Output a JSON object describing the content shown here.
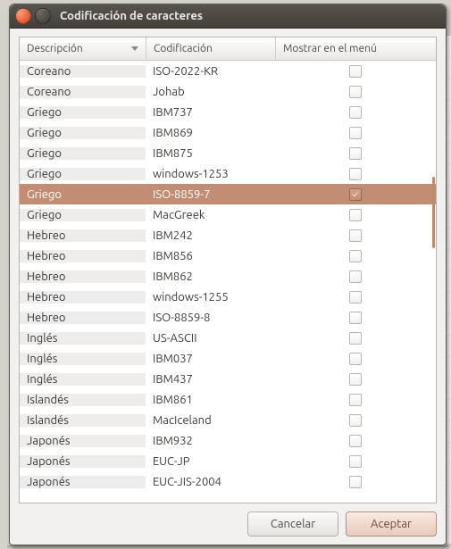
{
  "window": {
    "title": "Codificación de caracteres"
  },
  "table": {
    "headers": {
      "description": "Descripción",
      "encoding": "Codificación",
      "show": "Mostrar en el menú"
    },
    "rows": [
      {
        "desc": "Coreano",
        "enc": "ISO-2022-KR",
        "show": false,
        "selected": false
      },
      {
        "desc": "Coreano",
        "enc": "Johab",
        "show": false,
        "selected": false
      },
      {
        "desc": "Griego",
        "enc": "IBM737",
        "show": false,
        "selected": false
      },
      {
        "desc": "Griego",
        "enc": "IBM869",
        "show": false,
        "selected": false
      },
      {
        "desc": "Griego",
        "enc": "IBM875",
        "show": false,
        "selected": false
      },
      {
        "desc": "Griego",
        "enc": "windows-1253",
        "show": false,
        "selected": false
      },
      {
        "desc": "Griego",
        "enc": "ISO-8859-7",
        "show": true,
        "selected": true
      },
      {
        "desc": "Griego",
        "enc": "MacGreek",
        "show": false,
        "selected": false
      },
      {
        "desc": "Hebreo",
        "enc": "IBM242",
        "show": false,
        "selected": false
      },
      {
        "desc": "Hebreo",
        "enc": "IBM856",
        "show": false,
        "selected": false
      },
      {
        "desc": "Hebreo",
        "enc": "IBM862",
        "show": false,
        "selected": false
      },
      {
        "desc": "Hebreo",
        "enc": "windows-1255",
        "show": false,
        "selected": false
      },
      {
        "desc": "Hebreo",
        "enc": "ISO-8859-8",
        "show": false,
        "selected": false
      },
      {
        "desc": "Inglés",
        "enc": "US-ASCII",
        "show": false,
        "selected": false
      },
      {
        "desc": "Inglés",
        "enc": "IBM037",
        "show": false,
        "selected": false
      },
      {
        "desc": "Inglés",
        "enc": "IBM437",
        "show": false,
        "selected": false
      },
      {
        "desc": "Islandés",
        "enc": "IBM861",
        "show": false,
        "selected": false
      },
      {
        "desc": "Islandés",
        "enc": "MacIceland",
        "show": false,
        "selected": false
      },
      {
        "desc": "Japonés",
        "enc": "IBM932",
        "show": false,
        "selected": false
      },
      {
        "desc": "Japonés",
        "enc": "EUC-JP",
        "show": false,
        "selected": false
      },
      {
        "desc": "Japonés",
        "enc": "EUC-JIS-2004",
        "show": false,
        "selected": false
      }
    ]
  },
  "buttons": {
    "cancel": "Cancelar",
    "accept": "Aceptar"
  }
}
